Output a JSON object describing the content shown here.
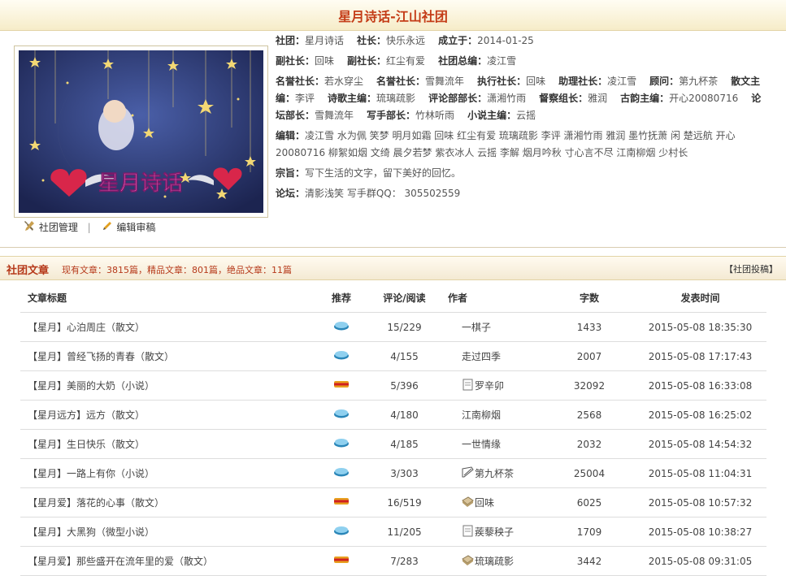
{
  "page_title": "星月诗话-江山社团",
  "logo_text": "星月诗话",
  "info": {
    "row1": [
      {
        "label": "社团：",
        "value": "星月诗话"
      },
      {
        "label": "社长：",
        "value": "快乐永远"
      },
      {
        "label": "成立于：",
        "value": "2014-01-25"
      }
    ],
    "row2": [
      {
        "label": "副社长：",
        "value": "回味"
      },
      {
        "label": "副社长：",
        "value": "红尘有爱"
      },
      {
        "label": "社团总编：",
        "value": "凌江雪"
      }
    ],
    "row3_text": [
      {
        "label": "名誉社长：",
        "value": "若水穿尘"
      },
      {
        "label": "名誉社长：",
        "value": "雪舞流年"
      },
      {
        "label": "执行社长：",
        "value": "回味"
      },
      {
        "label": "助理社长：",
        "value": "凌江雪"
      },
      {
        "label": "顾问：",
        "value": "第九杯茶"
      },
      {
        "label": "散文主编：",
        "value": "李评"
      },
      {
        "label": "诗歌主编：",
        "value": "琉璃疏影"
      },
      {
        "label": "评论部部长：",
        "value": "潇湘竹雨"
      },
      {
        "label": "督察组长：",
        "value": "雅润"
      },
      {
        "label": "古韵主编：",
        "value": "开心20080716"
      },
      {
        "label": "论坛部长：",
        "value": "雪舞流年"
      },
      {
        "label": "写手部长：",
        "value": "竹林听雨"
      },
      {
        "label": "小说主编：",
        "value": "云摇"
      }
    ],
    "editors_label": "编辑：",
    "editors": "凌江雪  水为佩  笑梦  明月如霜  回味  红尘有爱  琉璃疏影  李评  潇湘竹雨  雅润  墨竹抚萧  闲  楚远航  开心20080716  柳絮如烟  文绮  晨夕若梦  紫衣冰人  云摇  李解  烟月吟秋  寸心言不尽  江南柳烟  少村长",
    "motto_label": "宗旨：",
    "motto": "写下生活的文字，留下美好的回忆。",
    "forum_label": "论坛：",
    "forum": "清影浅笑 写手群QQ： 305502559"
  },
  "manage": {
    "club_manage": "社团管理",
    "sep": "|",
    "edit_review": "编辑审稿"
  },
  "articles": {
    "heading": "社团文章",
    "stats": "现有文章：3815篇，精品文章：801篇，绝品文章：11篇",
    "submit": "【社团投稿】",
    "columns": [
      "文章标题",
      "推荐",
      "评论/阅读",
      "作者",
      "字数",
      "发表时间"
    ],
    "rows": [
      {
        "title": "【星月】心泊周庄（散文）",
        "rec": "blue",
        "cr": "15/229",
        "author": "一棋子",
        "icon": "",
        "words": "1433",
        "time": "2015-05-08 18:35:30"
      },
      {
        "title": "【星月】曾经飞扬的青春（散文）",
        "rec": "blue",
        "cr": "4/155",
        "author": "走过四季",
        "icon": "",
        "words": "2007",
        "time": "2015-05-08 17:17:43"
      },
      {
        "title": "【星月】美丽的大奶（小说）",
        "rec": "red",
        "cr": "5/396",
        "author": "罗辛卯",
        "icon": "page",
        "words": "32092",
        "time": "2015-05-08 16:33:08"
      },
      {
        "title": "【星月远方】远方（散文）",
        "rec": "blue",
        "cr": "4/180",
        "author": "江南柳烟",
        "icon": "",
        "words": "2568",
        "time": "2015-05-08 16:25:02"
      },
      {
        "title": "【星月】生日快乐（散文）",
        "rec": "blue",
        "cr": "4/185",
        "author": "一世情缘",
        "icon": "",
        "words": "2032",
        "time": "2015-05-08 14:54:32"
      },
      {
        "title": "【星月】一路上有你（小说）",
        "rec": "blue",
        "cr": "3/303",
        "author": "第九杯茶",
        "icon": "pen",
        "words": "25004",
        "time": "2015-05-08 11:04:31"
      },
      {
        "title": "【星月爱】落花的心事（散文）",
        "rec": "red",
        "cr": "16/519",
        "author": "回味",
        "icon": "book",
        "words": "6025",
        "time": "2015-05-08 10:57:32"
      },
      {
        "title": "【星月】大黑狗（微型小说）",
        "rec": "blue",
        "cr": "11/205",
        "author": "蒺藜秧子",
        "icon": "page",
        "words": "1709",
        "time": "2015-05-08 10:38:27"
      },
      {
        "title": "【星月爱】那些盛开在流年里的爱（散文）",
        "rec": "red",
        "cr": "7/283",
        "author": "琉璃疏影",
        "icon": "book",
        "words": "3442",
        "time": "2015-05-08 09:31:05"
      }
    ]
  }
}
